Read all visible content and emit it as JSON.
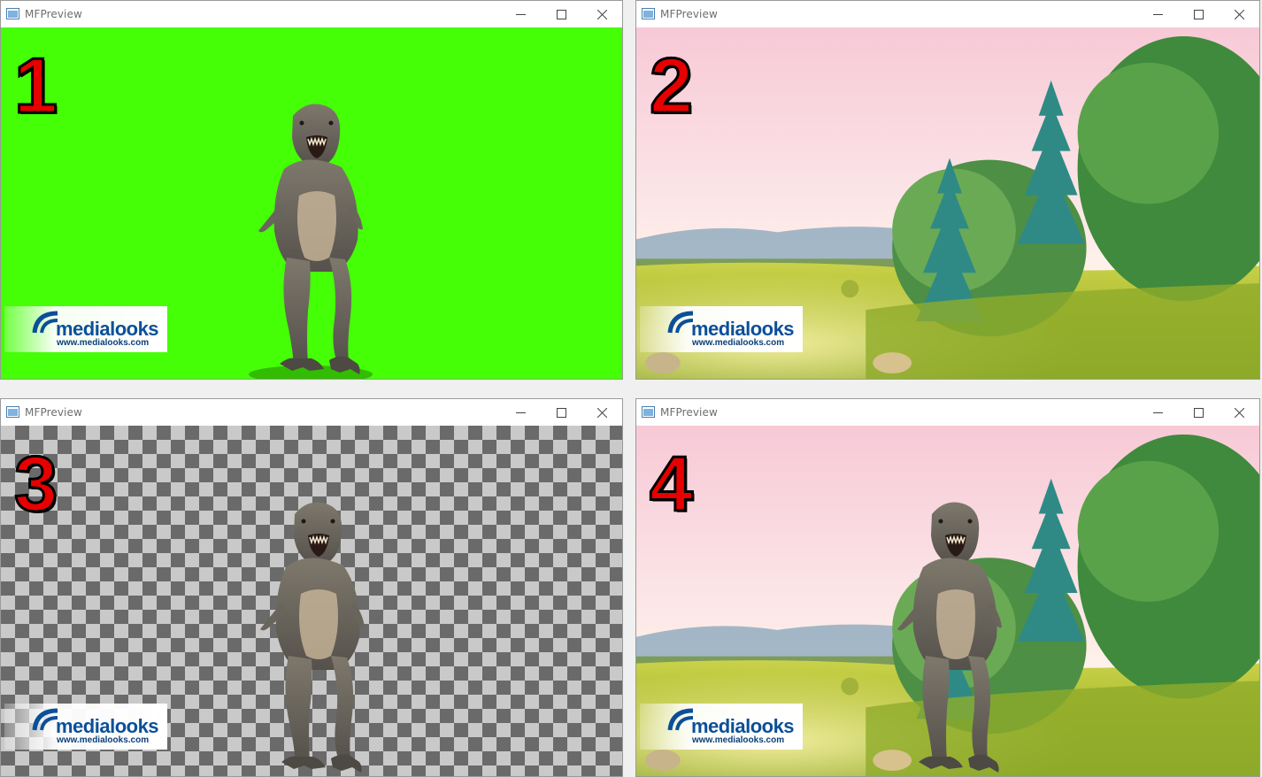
{
  "windows": [
    {
      "title": "MFPreview",
      "badge": "1",
      "logo": {
        "name": "medialooks",
        "url": "www.medialooks.com"
      }
    },
    {
      "title": "MFPreview",
      "badge": "2",
      "logo": {
        "name": "medialooks",
        "url": "www.medialooks.com"
      }
    },
    {
      "title": "MFPreview",
      "badge": "3",
      "logo": {
        "name": "medialooks",
        "url": "www.medialooks.com"
      }
    },
    {
      "title": "MFPreview",
      "badge": "4",
      "logo": {
        "name": "medialooks",
        "url": "www.medialooks.com"
      }
    }
  ],
  "colors": {
    "chroma_green": "#44ff05",
    "badge_red": "#e60000",
    "logo_blue": "#0b4f99",
    "checker_dark": "#6a6a6a",
    "checker_light": "#c9c9c9"
  },
  "icons": {
    "app": "app-window-icon",
    "minimize": "minimize-icon",
    "maximize": "maximize-icon",
    "close": "close-icon"
  }
}
